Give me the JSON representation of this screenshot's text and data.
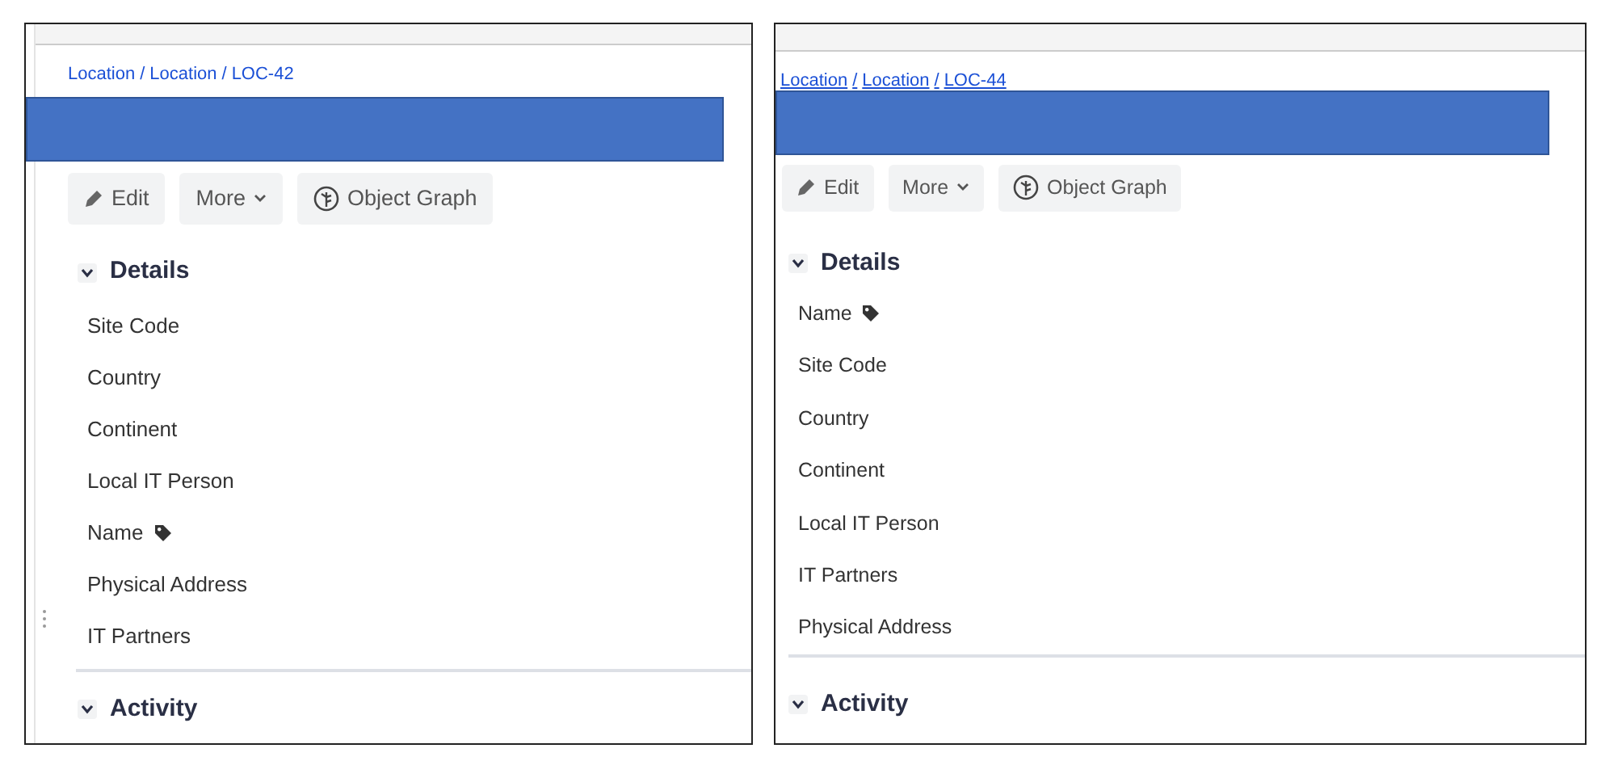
{
  "panels": [
    {
      "breadcrumb": [
        {
          "label": "Location"
        },
        {
          "label": "Location"
        },
        {
          "label": "LOC-42"
        }
      ],
      "separator": "/",
      "breadcrumb_underlined": false,
      "drag_handle": true,
      "buttons": [
        {
          "kind": "edit",
          "label": "Edit"
        },
        {
          "kind": "dropdown",
          "label": "More"
        },
        {
          "kind": "graph",
          "label": "Object Graph"
        }
      ],
      "sections": [
        {
          "title": "Details",
          "expanded": true,
          "fields": [
            {
              "label": "Site Code",
              "tag": false
            },
            {
              "label": "Country",
              "tag": false
            },
            {
              "label": "Continent",
              "tag": false
            },
            {
              "label": "Local IT Person",
              "tag": false
            },
            {
              "label": "Name",
              "tag": true
            },
            {
              "label": "Physical Address",
              "tag": false
            },
            {
              "label": "IT Partners",
              "tag": false
            }
          ]
        },
        {
          "title": "Activity",
          "expanded": true
        }
      ]
    },
    {
      "breadcrumb": [
        {
          "label": "Location"
        },
        {
          "label": "Location"
        },
        {
          "label": "LOC-44"
        }
      ],
      "separator": "/",
      "breadcrumb_underlined": true,
      "drag_handle": false,
      "buttons": [
        {
          "kind": "edit",
          "label": "Edit"
        },
        {
          "kind": "dropdown",
          "label": "More"
        },
        {
          "kind": "graph",
          "label": "Object Graph"
        }
      ],
      "sections": [
        {
          "title": "Details",
          "expanded": true,
          "fields": [
            {
              "label": "Name",
              "tag": true
            },
            {
              "label": "Site Code",
              "tag": false
            },
            {
              "label": "Country",
              "tag": false
            },
            {
              "label": "Continent",
              "tag": false
            },
            {
              "label": "Local IT Person",
              "tag": false
            },
            {
              "label": "IT Partners",
              "tag": false
            },
            {
              "label": "Physical Address",
              "tag": false
            }
          ]
        },
        {
          "title": "Activity",
          "expanded": true
        }
      ]
    }
  ]
}
